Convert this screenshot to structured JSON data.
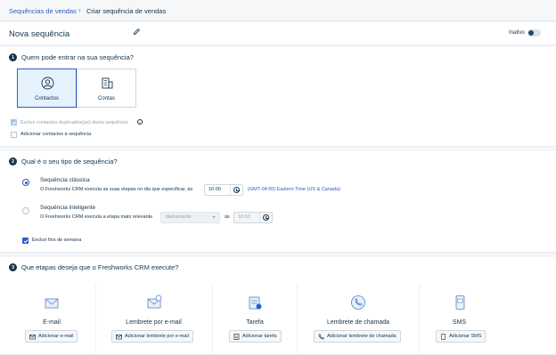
{
  "breadcrumb": {
    "parent": "Sequências de vendas",
    "separator": "›",
    "current": "Criar sequência de vendas"
  },
  "header": {
    "title": "Nova sequência",
    "status_label": "Inativo",
    "status_on": false
  },
  "section1": {
    "number": "1",
    "title": "Quem pode entrar na sua sequência?",
    "cards": [
      {
        "label": "Contactos",
        "selected": true
      },
      {
        "label": "Contas",
        "selected": false
      }
    ],
    "exclude_duplicates_label": "Excluir contactos duplicados(as) desta sequência",
    "info_glyph": "i",
    "add_contacts_label": "Adicionar contactos à sequência"
  },
  "section2": {
    "number": "2",
    "title": "Qual é o seu tipo de sequência?",
    "classic_title": "Sequência clássica",
    "classic_desc": "O Freshworks CRM executa as suas etapas no dia que especificar, às",
    "classic_time": "16:00",
    "timezone": "(GMT-04:00) Eastern Time (US & Canada)",
    "smart_title": "Sequência inteligente",
    "smart_desc": "O Freshworks CRM executa a etapa mais relevante",
    "smart_frequency": "diariamente",
    "smart_at": "às",
    "smart_time": "16:00",
    "exclude_weekends_label": "Excluir fins de semana"
  },
  "section3": {
    "number": "3",
    "title": "Que etapas deseja que o Freshworks CRM execute?",
    "steps": [
      {
        "name": "E-mail",
        "button": "Adicionar e-mail",
        "icon": "envelope-icon"
      },
      {
        "name": "Lembrete por e-mail",
        "button": "Adicionar lembrete por e-mail",
        "icon": "email-reminder-icon"
      },
      {
        "name": "Tarefa",
        "button": "Adicionar tarefa",
        "icon": "task-icon"
      },
      {
        "name": "Lembrete de chamada",
        "button": "Adicionar lembrete de chamada",
        "icon": "phone-icon"
      },
      {
        "name": "SMS",
        "button": "Adicionar SMS",
        "icon": "sms-icon"
      }
    ]
  },
  "colors": {
    "accent": "#2c5cc5",
    "text": "#12344d",
    "muted": "#92a2b1",
    "background": "#f3f5f8"
  }
}
